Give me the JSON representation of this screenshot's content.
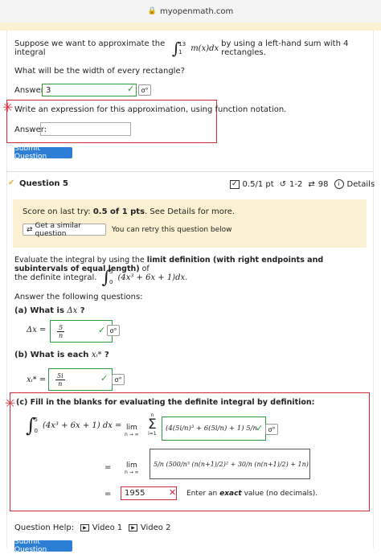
{
  "browser": {
    "url": "myopenmath.com"
  },
  "q4": {
    "prompt_pre": "Suppose we want to approximate the integral",
    "upper": "13",
    "lower": "1",
    "integrand": "m(x)dx",
    "prompt_post": "by using a left-hand sum with 4 rectangles.",
    "width_q": "What will be the width of every rectangle?",
    "answer_label": "Answer:",
    "answer_value": "3",
    "expr_q": "Write an expression for this approximation, using function notation.",
    "answer2_label": "Answer:",
    "answer2_value": "",
    "submit_label": "Submit Question"
  },
  "q5": {
    "title": "Question 5",
    "score": "0.5/1 pt",
    "tries": "1-2",
    "refresh": "98",
    "details": "Details",
    "score_text_pre": "Score on last try: ",
    "score_text_bold": "0.5 of 1 pts",
    "score_text_post": ". See Details for more.",
    "similar_label": "Get a similar question",
    "retry_text": "You can retry this question below",
    "eval_pre": "Evaluate the integral by using the ",
    "eval_bold": "limit definition (with right endpoints and subintervals of equal length)",
    "eval_post": " of",
    "eval_line2": "the definite integral.",
    "integral_upper": "5",
    "integral_lower": "0",
    "integral_body": "(4x³ + 6x + 1)dx.",
    "answer_following": "Answer the following questions:",
    "a_label": "(a) What is",
    "a_var": "Δx",
    "a_q": "?",
    "a_lhs": "Δx =",
    "a_num": "5",
    "a_den": "n",
    "b_label": "(b) What is each",
    "b_var": "xᵢ*",
    "b_q": "?",
    "b_lhs": "xᵢ* =",
    "b_num": "5i",
    "b_den": "n",
    "c_label": "(c) Fill in the blanks for evaluating the definite integral by definition:",
    "c_integral": "(4x³ + 6x + 1) dx =",
    "c_lim": "lim",
    "c_lim_sub": "n → ∞",
    "c_sum_top": "n",
    "c_sum_bot": "i=1",
    "c_row1": "(4(5i/n)³ + 6(5i/n) + 1) 5/n",
    "c_eq2": "=",
    "c_row2": "5/n (500/n³ (n(n+1)/2)² + 30/n (n(n+1)/2) + 1n)",
    "c_eq3": "=",
    "c_final_value": "1955",
    "c_final_hint_pre": "Enter an ",
    "c_final_hint_em": "exact",
    "c_final_hint_post": " value (no decimals).",
    "help_label": "Question Help:",
    "video1": "Video 1",
    "video2": "Video 2",
    "submit_label": "Submit Question"
  },
  "colors": {
    "accent": "#2d7fd6",
    "correct": "#2b9a3a",
    "wrong": "#cf2b38",
    "panel": "#fbf1d2"
  }
}
